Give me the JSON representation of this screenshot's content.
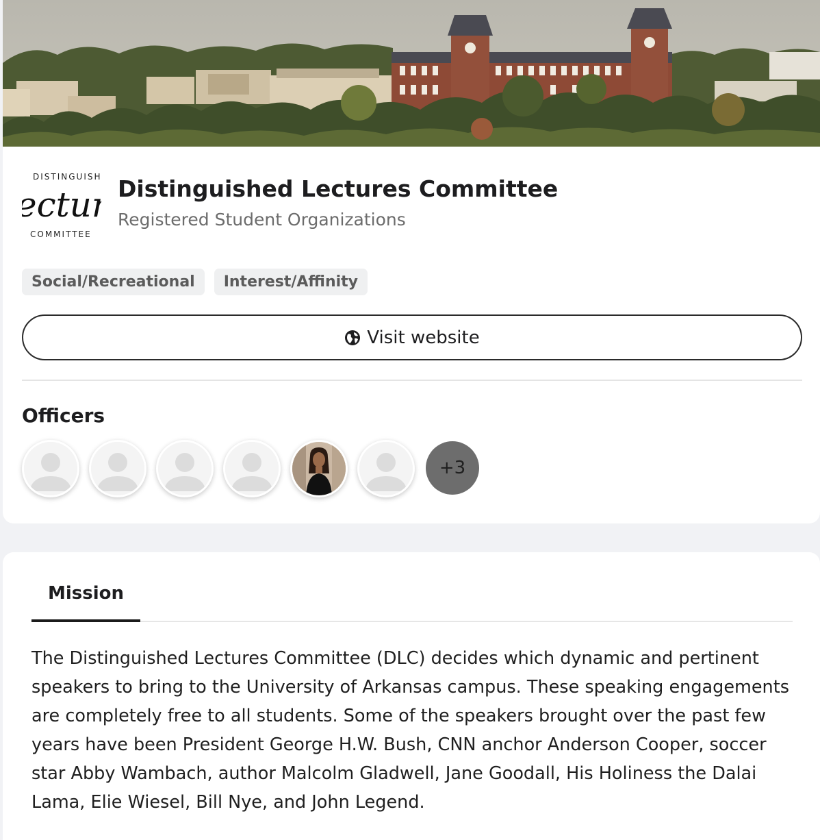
{
  "organization": {
    "name": "Distinguished Lectures Committee",
    "category": "Registered Student Organizations",
    "logo_text": {
      "top": "DISTINGUISHED",
      "middle": "ectur",
      "bottom": "COMMITTEE"
    },
    "tags": [
      "Social/Recreational",
      "Interest/Affinity"
    ],
    "website_button_label": "Visit website",
    "website_icon": "globe-icon"
  },
  "officers": {
    "title": "Officers",
    "avatars": [
      {
        "type": "placeholder"
      },
      {
        "type": "placeholder"
      },
      {
        "type": "placeholder"
      },
      {
        "type": "placeholder"
      },
      {
        "type": "photo"
      },
      {
        "type": "placeholder"
      }
    ],
    "more_count_label": "+3"
  },
  "mission": {
    "tab_label": "Mission",
    "text": "The Distinguished Lectures Committee (DLC) decides which dynamic and pertinent speakers to bring to the University of Arkansas campus. These speaking engagements are completely free to all students. Some of the speakers brought over the past few years have been President George H.W. Bush, CNN anchor Anderson Cooper, soccer star Abby Wambach, author Malcolm Gladwell, Jane Goodall, His Holiness the Dalai Lama, Elie Wiesel, Bill Nye, and John Legend."
  },
  "colors": {
    "page_background": "#f1f2f5",
    "card_background": "#ffffff",
    "tag_background": "#eff0f1",
    "more_avatar_background": "#6d6d6d"
  }
}
